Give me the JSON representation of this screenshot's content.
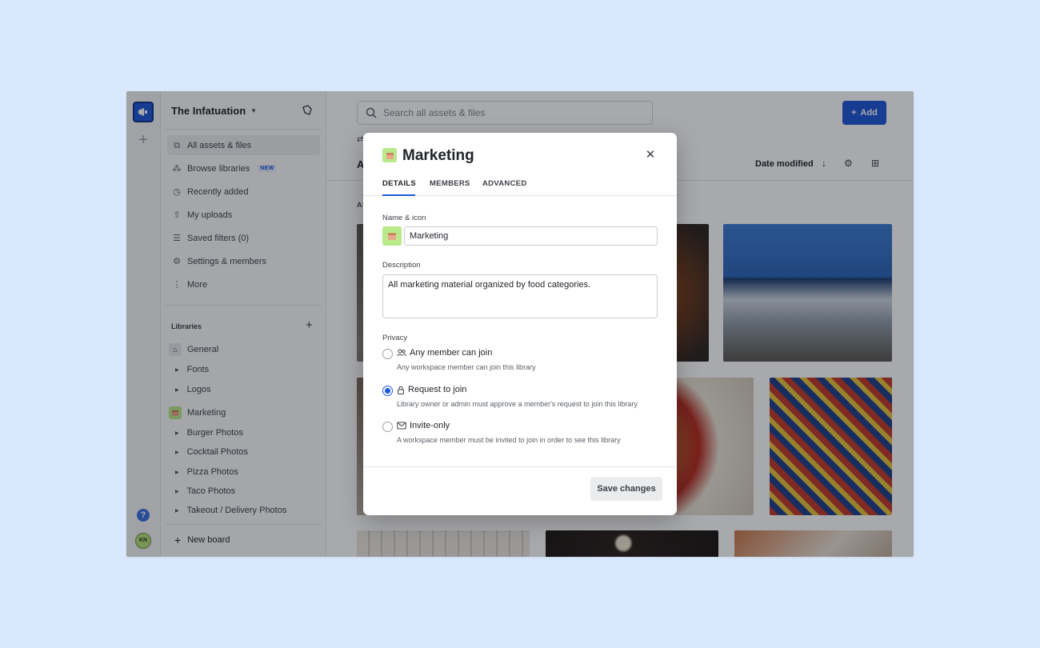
{
  "workspace": {
    "name": "The Infatuation"
  },
  "rail": {
    "help": "?",
    "avatar_initials": "KN"
  },
  "sidebar": {
    "nav": [
      {
        "label": "All assets & files",
        "icon": "assets-icon"
      },
      {
        "label": "Browse libraries",
        "icon": "libraries-icon",
        "badge": "NEW"
      },
      {
        "label": "Recently added",
        "icon": "clock-icon"
      },
      {
        "label": "My uploads",
        "icon": "upload-icon"
      },
      {
        "label": "Saved filters (0)",
        "icon": "filter-icon"
      },
      {
        "label": "Settings & members",
        "icon": "gear-icon"
      },
      {
        "label": "More",
        "icon": "more-icon"
      }
    ],
    "libraries_header": "Libraries",
    "libraries": {
      "general": "General",
      "general_children": [
        "Fonts",
        "Logos"
      ],
      "marketing": "Marketing",
      "marketing_children": [
        "Burger Photos",
        "Cocktail Photos",
        "Pizza Photos",
        "Taco Photos",
        "Takeout / Delivery Photos"
      ]
    },
    "new_board": "New board"
  },
  "main": {
    "search_placeholder": "Search all assets & files",
    "add_label": "Add",
    "heading_partial": "A",
    "section_partial": "AS",
    "sort_label": "Date modified"
  },
  "modal": {
    "title": "Marketing",
    "tabs": [
      "DETAILS",
      "MEMBERS",
      "ADVANCED"
    ],
    "name_label": "Name & icon",
    "name_value": "Marketing",
    "description_label": "Description",
    "description_value": "All marketing material organized by food categories.",
    "privacy_label": "Privacy",
    "privacy_options": [
      {
        "title": "Any member can join",
        "desc": "Any workspace member can join this library",
        "icon": "users-icon"
      },
      {
        "title": "Request to join",
        "desc": "Library owner or admin must approve a member's request to join this library",
        "icon": "lock-icon"
      },
      {
        "title": "Invite-only",
        "desc": "A workspace member must be invited to join in order to see this library",
        "icon": "mail-icon"
      }
    ],
    "selected_privacy": 1,
    "save_label": "Save changes"
  },
  "colors": {
    "accent": "#1d57d6",
    "overlay": "rgba(15,18,24,0.36)",
    "library_swatch": "#b9e98a"
  }
}
